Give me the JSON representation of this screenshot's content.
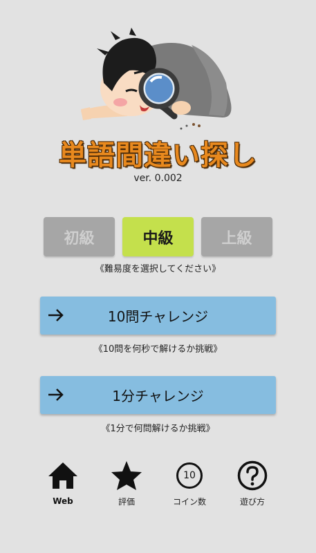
{
  "app": {
    "title": "単語間違い探し",
    "version": "ver. 0.002"
  },
  "levels": [
    {
      "label": "初級",
      "selected": false
    },
    {
      "label": "中級",
      "selected": true
    },
    {
      "label": "上級",
      "selected": false
    }
  ],
  "level_hint": "《難易度を選択してください》",
  "challenges": [
    {
      "label": "10問チャレンジ",
      "hint": "《10問を何秒で解けるか挑戦》"
    },
    {
      "label": "1分チャレンジ",
      "hint": "《1分で何問解けるか挑戦》"
    }
  ],
  "bottom_nav": {
    "web": {
      "label": "Web",
      "icon": "home-icon"
    },
    "rate": {
      "label": "評価",
      "icon": "star-icon"
    },
    "coins": {
      "label": "コイン数",
      "icon": "coin-icon",
      "count": "10"
    },
    "howto": {
      "label": "遊び方",
      "icon": "question-icon"
    }
  },
  "colors": {
    "background": "#e2e2e2",
    "level_selected": "#c4e04c",
    "level_unselected": "#a6a6a6",
    "challenge_button": "#86bde0",
    "title": "#e8891e"
  }
}
